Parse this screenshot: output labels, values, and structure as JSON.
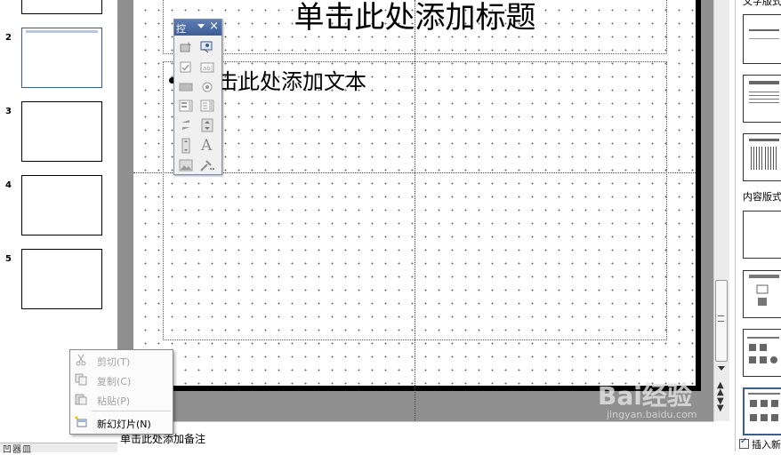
{
  "thumbnails": [
    {
      "num": "",
      "selected": false
    },
    {
      "num": "2",
      "selected": true
    },
    {
      "num": "3",
      "selected": false
    },
    {
      "num": "4",
      "selected": false
    },
    {
      "num": "5",
      "selected": false
    }
  ],
  "slide": {
    "title_placeholder": "单击此处添加标题",
    "body_placeholder": "击此处添加文本"
  },
  "notes": {
    "placeholder": "单击此处添加备注"
  },
  "toolbox": {
    "title": "控",
    "close": "×",
    "buttons": [
      "select-objects-icon",
      "more-controls-icon",
      "checkbox-icon",
      "textbox-icon",
      "command-button-icon",
      "option-button-icon",
      "listbox-icon",
      "combobox-icon",
      "toggle-button-icon",
      "spin-button-icon",
      "scrollbar-icon",
      "label-icon",
      "image-icon",
      "properties-icon"
    ]
  },
  "context_menu": {
    "items": [
      {
        "label": "剪切(T)",
        "enabled": false,
        "icon": "scissors-icon"
      },
      {
        "label": "复制(C)",
        "enabled": false,
        "icon": "copy-icon"
      },
      {
        "label": "粘贴(P)",
        "enabled": false,
        "icon": "paste-icon"
      },
      {
        "label": "新幻灯片(N)",
        "enabled": true,
        "icon": "new-slide-icon"
      }
    ]
  },
  "task_pane": {
    "text_layouts_label": "文字版式",
    "content_layouts_label": "内容版式",
    "insert_checkbox_label": "插入新"
  },
  "view_bar": {
    "label": "凹器皿"
  },
  "watermark": {
    "brand": "Bai经验",
    "url": "jingyan.baidu.com"
  }
}
